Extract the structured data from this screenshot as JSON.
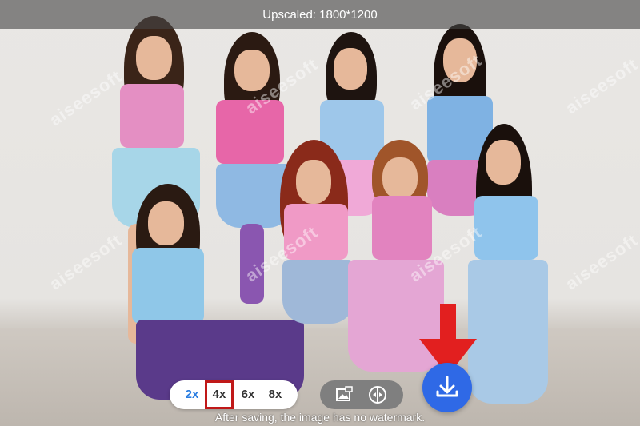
{
  "header": {
    "title": "Upscaled: 1800*1200"
  },
  "scale_options": [
    {
      "label": "2x",
      "state": "active"
    },
    {
      "label": "4x",
      "state": "selected"
    },
    {
      "label": "6x",
      "state": "normal"
    },
    {
      "label": "8x",
      "state": "normal"
    }
  ],
  "tools": [
    {
      "name": "image-compare-icon"
    },
    {
      "name": "split-view-icon"
    }
  ],
  "download": {
    "icon": "download-icon"
  },
  "footer": {
    "note": "After saving, the image has no watermark."
  },
  "watermark": {
    "text": "aiseesoft"
  },
  "colors": {
    "accent_blue": "#2f69e6",
    "highlight_red": "#c01818",
    "arrow_red": "#e21f1f",
    "topbar": "rgba(70,70,70,0.62)"
  }
}
